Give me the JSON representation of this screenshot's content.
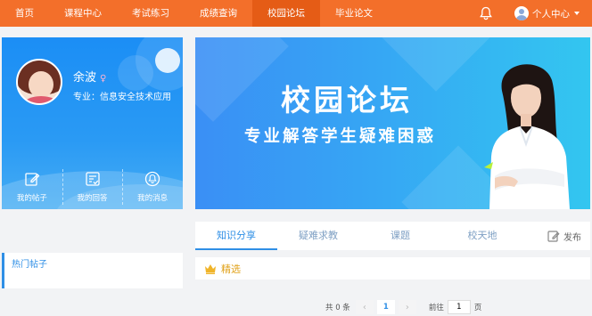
{
  "nav": {
    "items": [
      {
        "label": "首页",
        "active": false
      },
      {
        "label": "课程中心",
        "active": false
      },
      {
        "label": "考试练习",
        "active": false
      },
      {
        "label": "成绩查询",
        "active": false
      },
      {
        "label": "校园论坛",
        "active": true
      },
      {
        "label": "毕业论文",
        "active": false
      }
    ],
    "bell_icon": "bell-icon",
    "user_menu_label": "个人中心",
    "accent": "#f36f2a"
  },
  "profile": {
    "name": "余波",
    "gender_symbol": "♀",
    "major": "专业：信息安全技术应用",
    "actions": [
      {
        "label": "我的帖子",
        "icon": "edit-icon"
      },
      {
        "label": "我的回答",
        "icon": "list-check-icon"
      },
      {
        "label": "我的消息",
        "icon": "bell-icon"
      }
    ]
  },
  "hot_posts": {
    "title": "热门帖子"
  },
  "banner": {
    "title": "校园论坛",
    "subtitle": "专业解答学生疑难困惑"
  },
  "tabs": {
    "items": [
      {
        "label": "知识分享",
        "active": true
      },
      {
        "label": "疑难求教",
        "active": false
      },
      {
        "label": "课题",
        "active": false
      },
      {
        "label": "校天地",
        "active": false
      }
    ],
    "publish_label": "发布"
  },
  "featured": {
    "label": "精选",
    "icon": "crown-icon"
  },
  "pagination": {
    "total_text": "共 0 条",
    "prev_symbol": "‹",
    "current_page": "1",
    "next_symbol": "›",
    "goto_label": "前往",
    "goto_value": "1",
    "page_suffix": "页"
  }
}
